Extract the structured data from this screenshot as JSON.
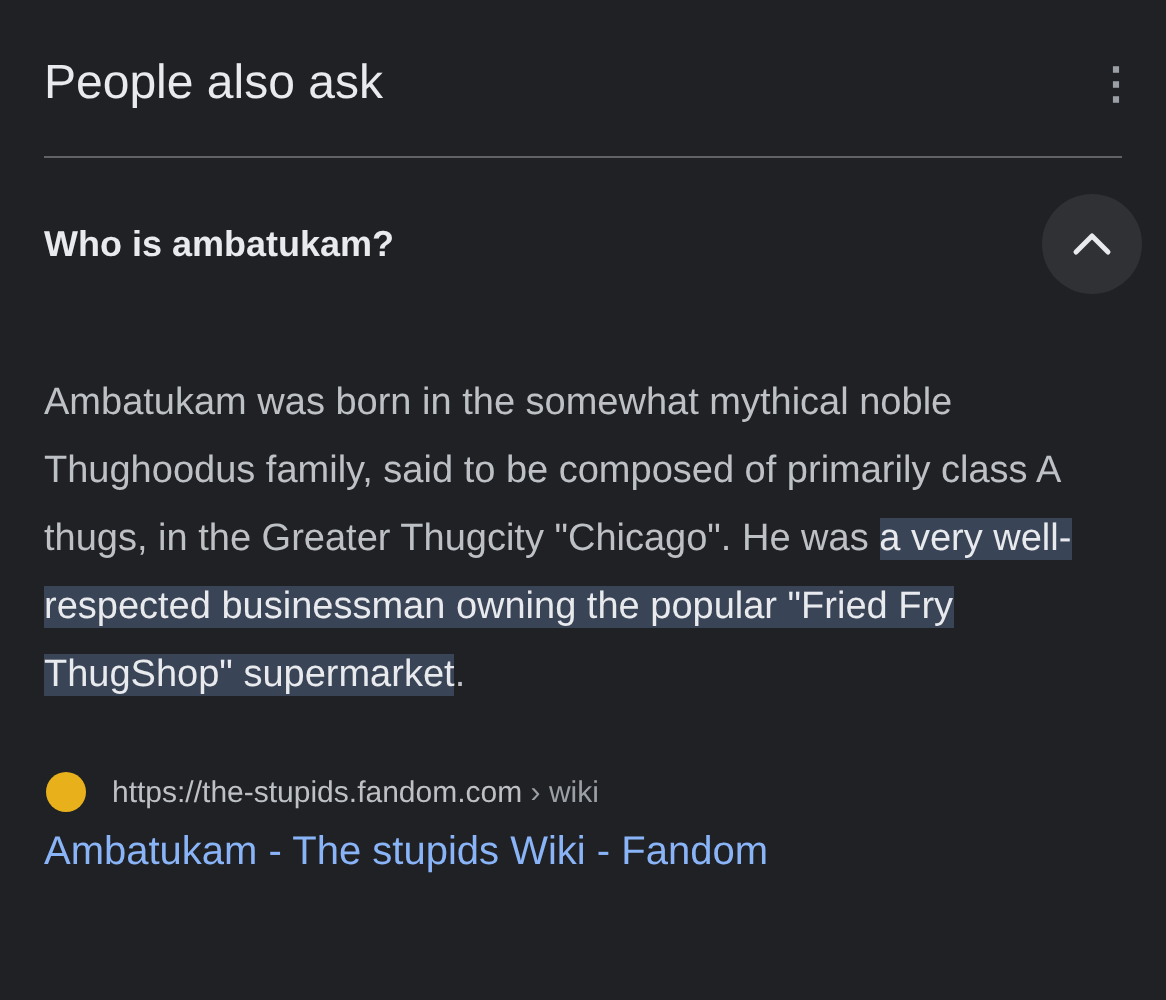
{
  "header": {
    "title": "People also ask",
    "menu_icon": "⋮"
  },
  "question": {
    "text": "Who is ambatukam?",
    "expanded": true
  },
  "answer": {
    "before": "Ambatukam was born in the somewhat mythical noble Thughoodus family, said to be composed of primarily class A thugs, in the Greater Thugcity \"Chicago\". He was ",
    "highlighted": "a very well-respected businessman owning the popular \"Fried Fry ThugShop\" supermarket",
    "after": "."
  },
  "source": {
    "url": "https://the-stupids.fandom.com",
    "path": "› wiki",
    "title": "Ambatukam - The stupids Wiki - Fandom"
  }
}
